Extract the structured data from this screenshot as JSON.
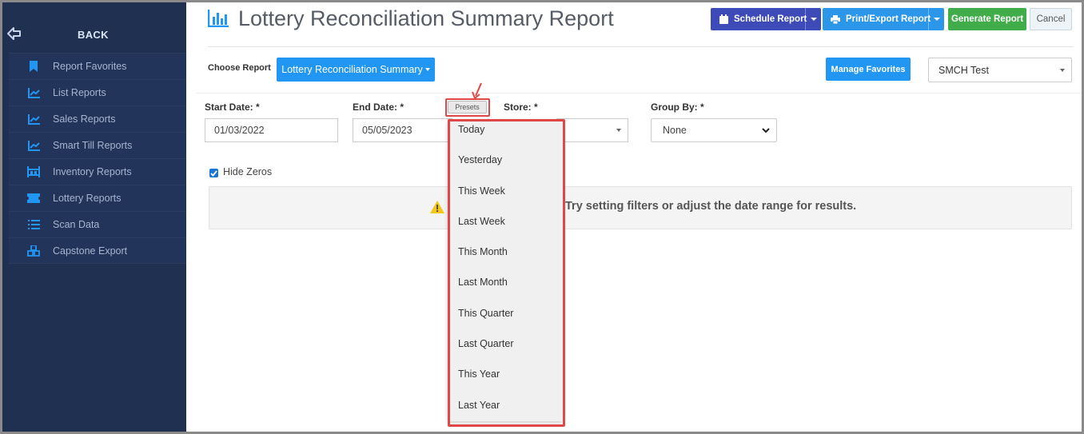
{
  "sidebar": {
    "back_label": "BACK",
    "items": [
      {
        "label": "Report Favorites",
        "icon": "bookmark-icon"
      },
      {
        "label": "List Reports",
        "icon": "line-chart-icon"
      },
      {
        "label": "Sales Reports",
        "icon": "line-chart-icon"
      },
      {
        "label": "Smart Till Reports",
        "icon": "line-chart-icon"
      },
      {
        "label": "Inventory Reports",
        "icon": "inventory-icon"
      },
      {
        "label": "Lottery Reports",
        "icon": "ticket-icon"
      },
      {
        "label": "Scan Data",
        "icon": "list-icon"
      },
      {
        "label": "Capstone Export",
        "icon": "boxes-icon"
      }
    ]
  },
  "header": {
    "title": "Lottery Reconciliation Summary Report",
    "schedule_label": "Schedule Report",
    "print_label": "Print/Export Report",
    "generate_label": "Generate Report",
    "cancel_label": "Cancel"
  },
  "report_row": {
    "choose_label": "Choose Report",
    "selected_report": "Lottery Reconciliation Summary",
    "manage_label": "Manage Favorites",
    "store_value": "SMCH Test"
  },
  "filters": {
    "start_label": "Start Date: *",
    "start_value": "01/03/2022",
    "end_label": "End Date: *",
    "end_value": "05/05/2023",
    "presets_label": "Presets",
    "store_label": "Store: *",
    "group_label": "Group By: *",
    "group_value": "None",
    "hide_zeros_label": "Hide Zeros",
    "hide_zeros_checked": true
  },
  "alert": {
    "text": "Try setting filters or adjust the date range for results."
  },
  "presets_menu": [
    "Today",
    "Yesterday",
    "This Week",
    "Last Week",
    "This Month",
    "Last Month",
    "This Quarter",
    "Last Quarter",
    "This Year",
    "Last Year"
  ],
  "colors": {
    "sidebar_bg": "#203050",
    "primary_blue": "#2196f3",
    "schedule_purple": "#3d4ab8",
    "generate_green": "#41ad4a",
    "highlight_red": "#e04848"
  }
}
